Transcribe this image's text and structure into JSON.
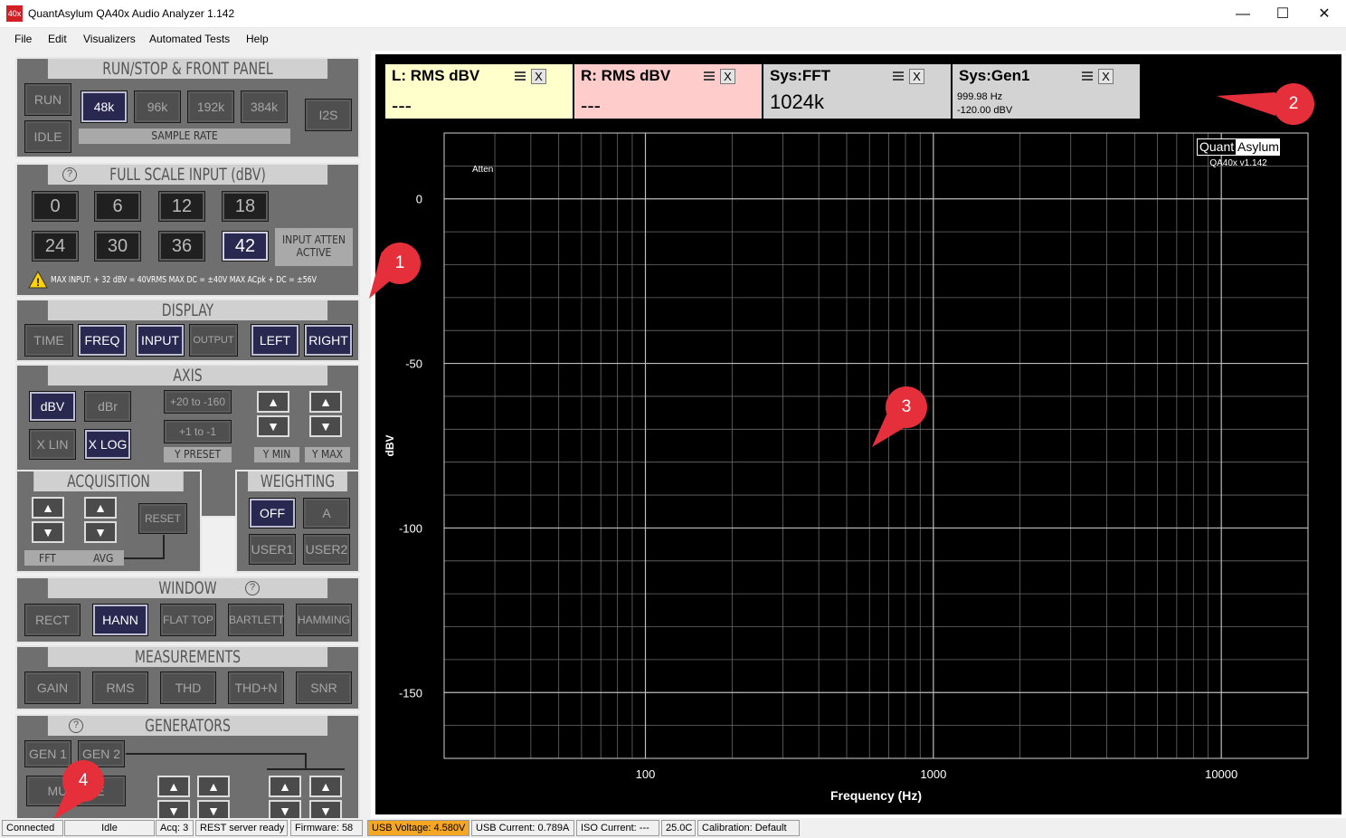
{
  "window": {
    "icon_text": "40x",
    "title": "QuantAsylum QA40x Audio Analyzer 1.142"
  },
  "menu": [
    "File",
    "Edit",
    "Visualizers",
    "Automated Tests",
    "Help"
  ],
  "run_stop": {
    "title": "RUN/STOP & FRONT PANEL",
    "run": "RUN",
    "idle": "IDLE",
    "rates": [
      "48k",
      "96k",
      "192k",
      "384k"
    ],
    "sample_rate_label": "SAMPLE RATE",
    "i2s": "I2S"
  },
  "full_scale": {
    "title": "FULL SCALE INPUT (dBV)",
    "help": "?",
    "values": [
      "0",
      "6",
      "12",
      "18",
      "24",
      "30",
      "36",
      "42"
    ],
    "selected": "42",
    "atten_label": "INPUT ATTEN ACTIVE",
    "warn_sign": "!",
    "warning": "MAX INPUT: + 32 dBV = 40VRMS    MAX DC = ±40V    MAX ACpk + DC = ±56V"
  },
  "display": {
    "title": "DISPLAY",
    "buttons": [
      "TIME",
      "FREQ",
      "INPUT",
      "OUTPUT",
      "LEFT",
      "RIGHT"
    ]
  },
  "axis": {
    "title": "AXIS",
    "dbv": "dBV",
    "dbr": "dBr",
    "xlin": "X LIN",
    "xlog": "X LOG",
    "preset1": "+20 to -160",
    "preset2": "+1 to -1",
    "y_preset": "Y PRESET",
    "y_min": "Y MIN",
    "y_max": "Y MAX",
    "up": "▲",
    "down": "▼"
  },
  "acquisition": {
    "title": "ACQUISITION",
    "reset": "RESET",
    "fft": "FFT",
    "avg": "AVG"
  },
  "weighting": {
    "title": "WEIGHTING",
    "off": "OFF",
    "a": "A",
    "user1": "USER1",
    "user2": "USER2"
  },
  "window_fn": {
    "title": "WINDOW",
    "help": "?",
    "buttons": [
      "RECT",
      "HANN",
      "FLAT TOP",
      "BARTLETT",
      "HAMMING"
    ]
  },
  "measurements": {
    "title": "MEASUREMENTS",
    "buttons": [
      "GAIN",
      "RMS",
      "THD",
      "THD+N",
      "SNR"
    ]
  },
  "generators": {
    "title": "GENERATORS",
    "help": "?",
    "gen1": "GEN 1",
    "gen2": "GEN 2",
    "mul": "MUL",
    "mul_suffix": "E"
  },
  "widgets": [
    {
      "title": "L: RMS dBV",
      "value": "---",
      "bg": "#ffffcc"
    },
    {
      "title": "R: RMS dBV",
      "value": "---",
      "bg": "#ffcccc"
    },
    {
      "title": "Sys:FFT",
      "value": "1024k",
      "bg": "#d3d3d3"
    },
    {
      "title": "Sys:Gen1",
      "line1": "999.98 Hz",
      "line2": "-120.00 dBV",
      "bg": "#d3d3d3"
    }
  ],
  "widget_close": "X",
  "chart_data": {
    "type": "line",
    "x_scale": "log",
    "xlim": [
      20,
      20000
    ],
    "ylim": [
      -170,
      20
    ],
    "xlabel": "Frequency (Hz)",
    "ylabel": "dBV",
    "x_ticks": [
      "100",
      "1000",
      "10000"
    ],
    "y_ticks": [
      "0",
      "-50",
      "-100",
      "-150"
    ],
    "annotation": "Atten",
    "grid": true,
    "logo_left": "Quant",
    "logo_right": "Asylum",
    "logo_version": "QA40x v1.142",
    "series": []
  },
  "markers": [
    "1",
    "2",
    "3",
    "4"
  ],
  "status": [
    {
      "text": "Connected"
    },
    {
      "text": "Idle"
    },
    {
      "text": "Acq: 3"
    },
    {
      "text": "REST server ready"
    },
    {
      "text": "Firmware: 58"
    },
    {
      "text": "USB Voltage: 4.580V",
      "warn": true
    },
    {
      "text": "USB Current: 0.789A"
    },
    {
      "text": "ISO Current: ---"
    },
    {
      "text": "25.0C"
    },
    {
      "text": "Calibration: Default"
    }
  ]
}
